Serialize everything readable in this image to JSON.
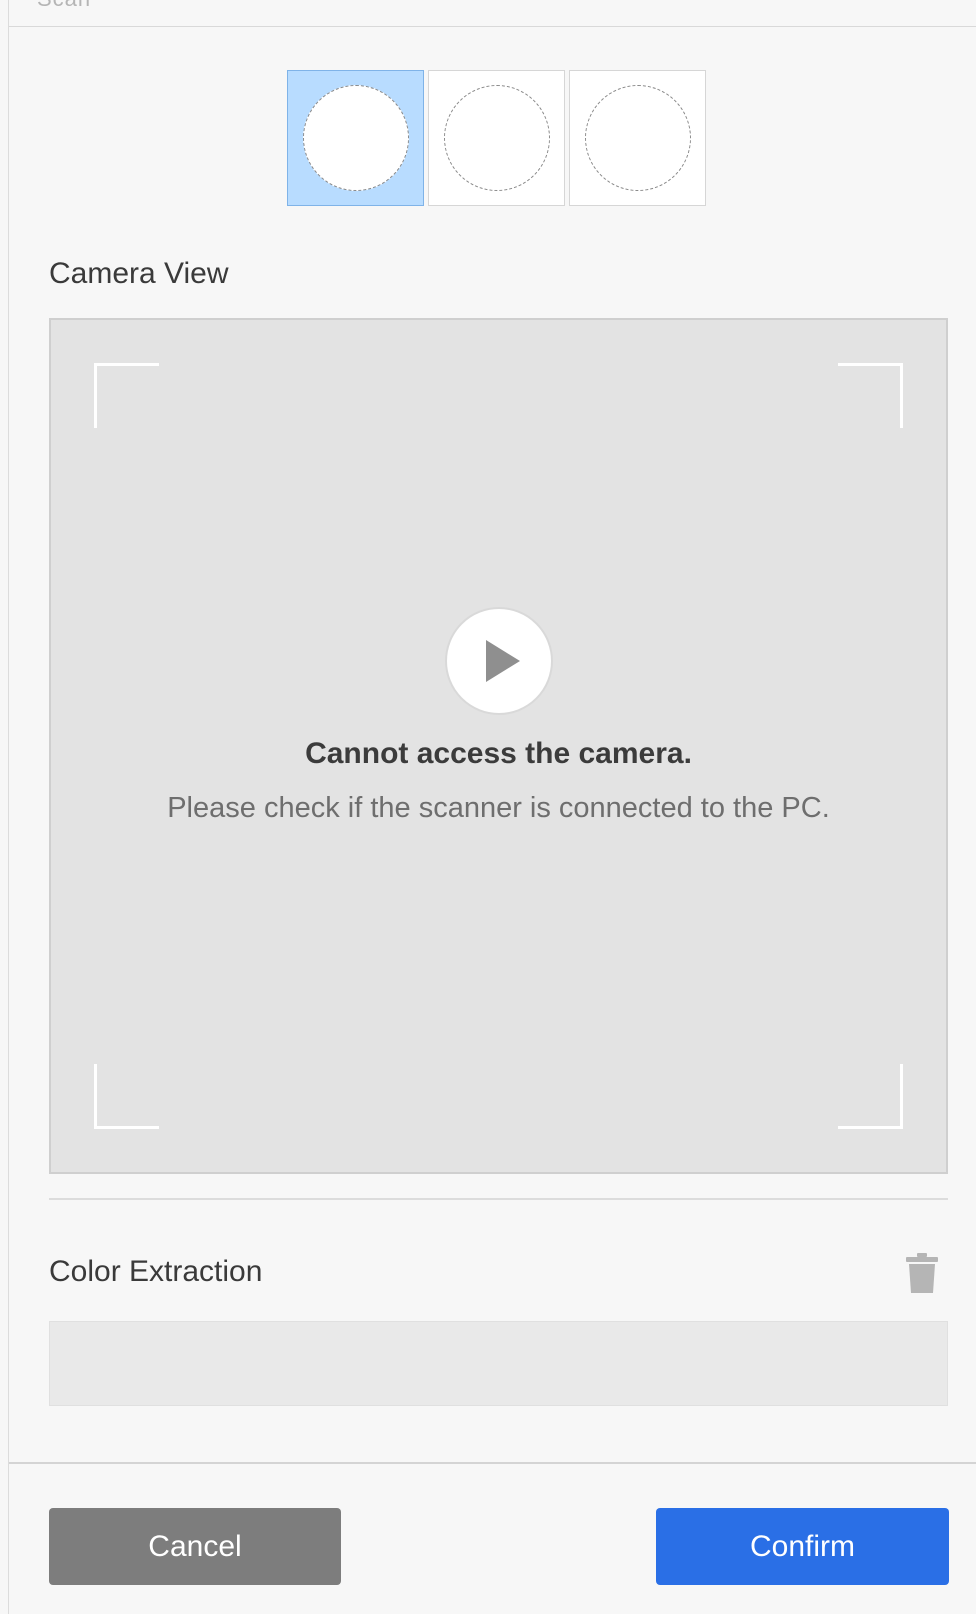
{
  "header": {
    "partial_title": "Scan"
  },
  "shape_selector": {
    "options": [
      {
        "icon": "circle-shape-icon",
        "selected": true
      },
      {
        "icon": "circle-shape-icon",
        "selected": false
      },
      {
        "icon": "circle-shape-icon",
        "selected": false
      }
    ]
  },
  "camera": {
    "label": "Camera View",
    "error_title": "Cannot access the camera.",
    "error_message": "Please check if the scanner is connected to the PC.",
    "play_icon": "play-icon"
  },
  "color_extraction": {
    "label": "Color Extraction",
    "delete_icon": "trash-icon",
    "value": ""
  },
  "footer": {
    "cancel_label": "Cancel",
    "confirm_label": "Confirm"
  },
  "colors": {
    "selected_bg": "#b8dcff",
    "confirm_bg": "#2a6fe6",
    "cancel_bg": "#7d7d7d",
    "camera_bg": "#e3e3e3"
  }
}
